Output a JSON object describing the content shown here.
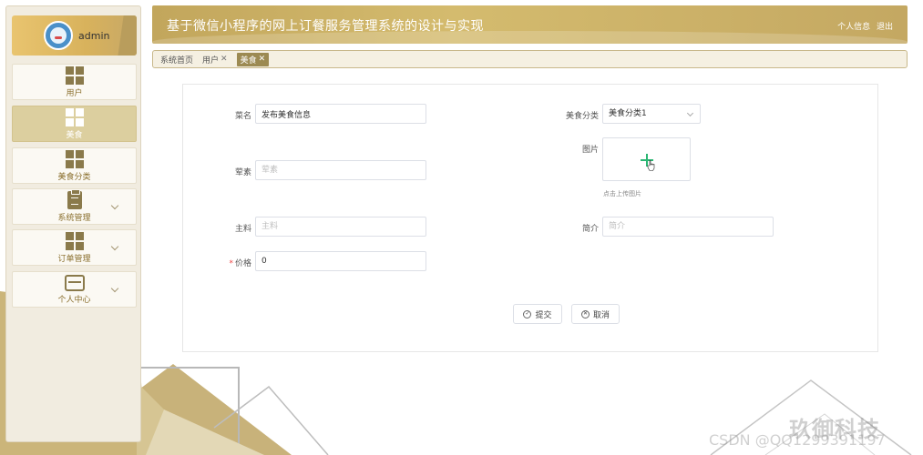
{
  "user": {
    "name": "admin"
  },
  "sidebar": {
    "items": [
      {
        "label": "用户",
        "icon": "grid-icon",
        "active": false
      },
      {
        "label": "美食",
        "icon": "grid-icon",
        "active": true
      },
      {
        "label": "美食分类",
        "icon": "grid-icon",
        "active": false
      },
      {
        "label": "系统管理",
        "icon": "clipboard-icon",
        "active": false,
        "expandable": true
      },
      {
        "label": "订单管理",
        "icon": "grid-icon",
        "active": false,
        "expandable": true
      },
      {
        "label": "个人中心",
        "icon": "card-icon",
        "active": false,
        "expandable": true
      }
    ]
  },
  "header": {
    "title": "基于微信小程序的网上订餐服务管理系统的设计与实现",
    "profile_link": "个人信息",
    "logout_link": "退出"
  },
  "breadcrumb": [
    {
      "label": "系统首页",
      "closable": false,
      "active": false
    },
    {
      "label": "用户",
      "closable": true,
      "active": false
    },
    {
      "label": "美食",
      "closable": true,
      "active": true
    }
  ],
  "form": {
    "dish_name": {
      "label": "菜名",
      "value": "发布美食信息"
    },
    "category": {
      "label": "美食分类",
      "value": "美食分类1"
    },
    "meat_veg": {
      "label": "荤素",
      "placeholder": "荤素"
    },
    "image": {
      "label": "图片",
      "tip": "点击上传图片"
    },
    "main_ingredient": {
      "label": "主料",
      "placeholder": "主料"
    },
    "intro": {
      "label": "简介",
      "placeholder": "简介"
    },
    "price": {
      "label": "价格",
      "value": "0",
      "required_mark": "*"
    },
    "submit_label": "提交",
    "cancel_label": "取消"
  },
  "watermark": {
    "brand": "玖御科技",
    "csdn": "CSDN @QQ1299391197"
  },
  "colors": {
    "accent": "#c2a65c",
    "active_nav": "#dccf9f",
    "plus": "#2bb673"
  }
}
